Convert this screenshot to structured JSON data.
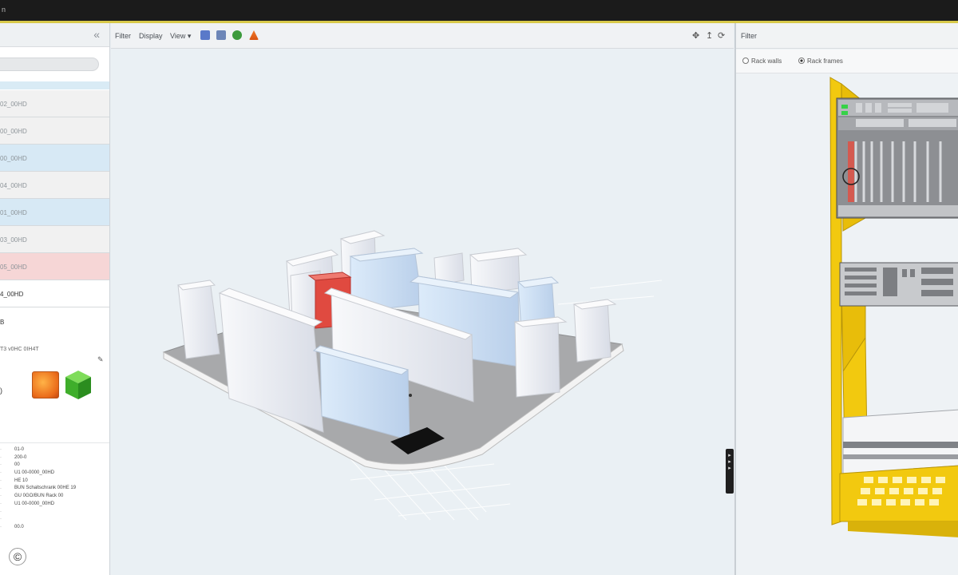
{
  "window": {
    "title_fragment": "n"
  },
  "left_panel": {
    "collapse_glyph": "«",
    "rack_rows": [
      {
        "label": "02_00HD",
        "style": "gray"
      },
      {
        "label": "00_00HD",
        "style": "gray"
      },
      {
        "label": "00_00HD",
        "style": "blue"
      },
      {
        "label": "04_00HD",
        "style": "gray"
      },
      {
        "label": "01_00HD",
        "style": "blue"
      },
      {
        "label": "03_00HD",
        "style": "gray"
      },
      {
        "label": "05_00HD",
        "style": "red"
      },
      {
        "label": "4_00HD",
        "style": "white"
      }
    ],
    "label_b": "B",
    "label_c": "T3 v0HC 0IH4T",
    "edit_glyph": "✎",
    "left_cut_text": ")",
    "properties": [
      "01-0",
      "200-0",
      "00",
      "U1 00-0000_00HD",
      "HE 10",
      "BUN Schaltschrank 00HE 19",
      "GU 0GO/BUN Rack 00",
      "U1 00-0000_00HD",
      "",
      "",
      "00.0"
    ],
    "copyright": "©"
  },
  "toolbar": {
    "filter": "Filter",
    "display": "Display",
    "view": "View ▾",
    "right_icons": [
      "✥",
      "↥",
      "⟳"
    ]
  },
  "right_panel": {
    "filter": "Filter",
    "radio_walls": "Rack walls",
    "radio_frames": "Rack frames",
    "selected": "frames"
  },
  "colors": {
    "accent_line": "#d8c94a",
    "rack_yellow": "#f2c90f",
    "highlight_red": "#e0473c",
    "selected_blue": "#cfe3f4"
  }
}
